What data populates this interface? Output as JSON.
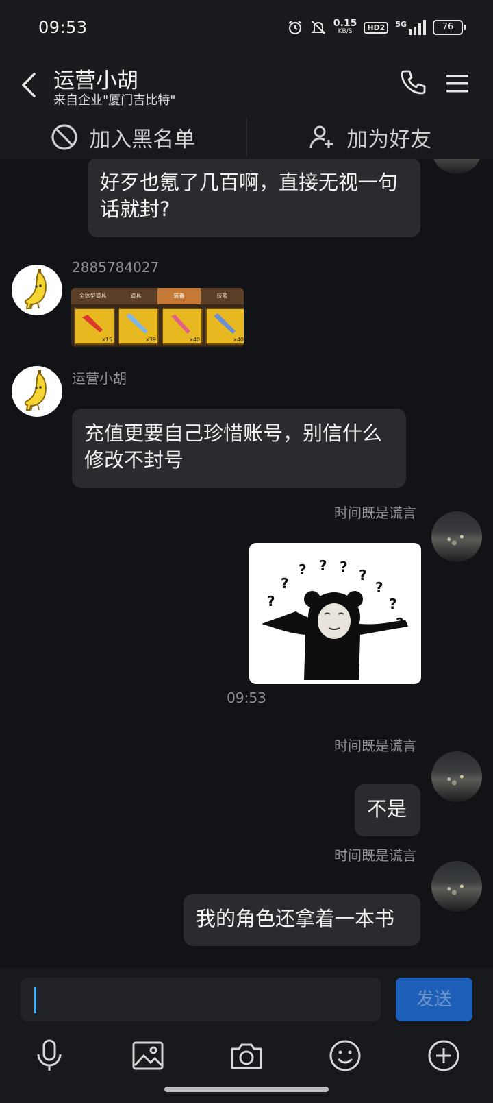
{
  "status": {
    "time": "09:53",
    "net_speed_value": "0.15",
    "net_speed_unit": "KB/S",
    "hd_label": "HD2",
    "signal_label": "5G",
    "battery": "76"
  },
  "header": {
    "title": "运营小胡",
    "subtitle": "来自企业\"厦门吉比特\""
  },
  "actions": {
    "block_label": "加入黑名单",
    "add_friend_label": "加为好友"
  },
  "messages": {
    "m1_text": "好歹也氪了几百啊，直接无视一句话就封?",
    "m2_sender": "2885784027",
    "m2_tabs": [
      "全体型道具",
      "道具",
      "装备",
      "技能"
    ],
    "m2_counts": [
      "x15",
      "x39",
      "x40",
      "x40"
    ],
    "m3_sender": "运营小胡",
    "m3_text": "充值更要自己珍惜账号，别信什么修改不封号",
    "m4_sender": "时间既是谎言",
    "time_separator": "09:53",
    "m5_sender": "时间既是谎言",
    "m5_text": "不是",
    "m6_sender": "时间既是谎言",
    "m6_text": "我的角色还拿着一本书"
  },
  "composer": {
    "input_value": "",
    "send_label": "发送"
  },
  "icons": [
    "alarm-icon",
    "mute-icon",
    "signal-icon",
    "back-icon",
    "phone-icon",
    "menu-icon",
    "block-icon",
    "add-friend-icon",
    "mic-icon",
    "image-icon",
    "camera-icon",
    "emoji-icon",
    "plus-icon"
  ],
  "colors": {
    "background": "#121316",
    "bubble": "#2a2b2f",
    "send_button": "#1d5fb8",
    "caret": "#3db3ff"
  }
}
